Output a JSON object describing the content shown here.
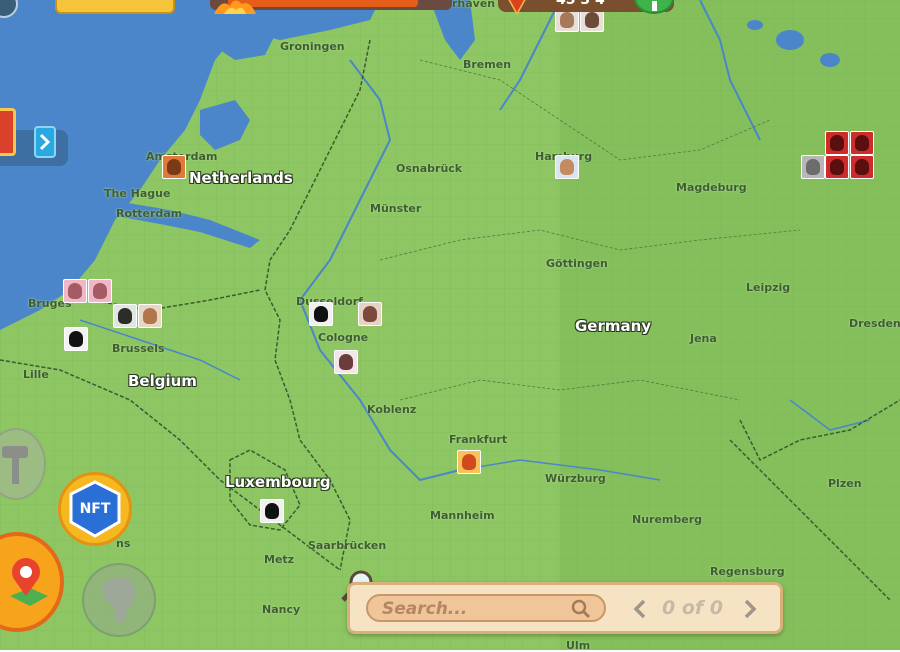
{
  "map": {
    "countries": [
      {
        "id": "netherlands",
        "label": "Netherlands"
      },
      {
        "id": "belgium",
        "label": "Belgium"
      },
      {
        "id": "germany",
        "label": "Germany"
      },
      {
        "id": "luxembourg",
        "label": "Luxembourg"
      }
    ],
    "cities": [
      "Groningen",
      "Bremen",
      "Amsterdam",
      "The Hague",
      "Rotterdam",
      "Osnabrück",
      "Hamburg",
      "Magdeburg",
      "Münster",
      "Göttingen",
      "Bruges",
      "Brussels",
      "Dusseldorf",
      "Cologne",
      "Leipzig",
      "Dresden",
      "Jena",
      "Lille",
      "Koblenz",
      "Frankfurt",
      "Würzburg",
      "Mannheim",
      "Nuremberg",
      "Plzen",
      "Saarbrücken",
      "Metz",
      "Regensburg",
      "Nancy",
      "Ulm",
      "ns",
      "rhaven"
    ]
  },
  "top_bar": {
    "counter_text": "45 3 4"
  },
  "buttons": {
    "nft_label": "NFT"
  },
  "search": {
    "placeholder": "Search...",
    "count_text": "0 of 0"
  },
  "colors": {
    "land": "#7fbf5a",
    "water": "#4a86c9",
    "nft_blue": "#2a6fd6",
    "nft_gold": "#f5b820",
    "panel": "#f6e3c3"
  }
}
